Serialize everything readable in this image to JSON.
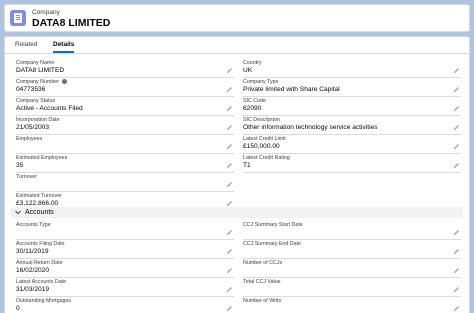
{
  "header": {
    "label": "Company",
    "title": "DATA8 LIMITED"
  },
  "tabs": [
    {
      "label": "Related",
      "active": false
    },
    {
      "label": "Details",
      "active": true
    }
  ],
  "fields": {
    "company_name": {
      "label": "Company Name",
      "value": "DATA8 LIMITED"
    },
    "company_number": {
      "label": "Company Number",
      "value": "04773536"
    },
    "company_status": {
      "label": "Company Status",
      "value": "Active - Accounts Filed"
    },
    "incorporation_date": {
      "label": "Incorporation Date",
      "value": "21/05/2003"
    },
    "employees": {
      "label": "Employees",
      "value": ""
    },
    "estimated_employees": {
      "label": "Estimated Employees",
      "value": "35"
    },
    "turnover": {
      "label": "Turnover",
      "value": ""
    },
    "estimated_turnover": {
      "label": "Estimated Turnover",
      "value": "£3,122,866.00"
    },
    "country": {
      "label": "Country",
      "value": "UK"
    },
    "company_type": {
      "label": "Company Type",
      "value": "Private limited with Share Capital"
    },
    "sic_code": {
      "label": "SIC Code",
      "value": "62090"
    },
    "sic_description": {
      "label": "SIC Description",
      "value": "Other information technology service activities"
    },
    "latest_credit_limit": {
      "label": "Latest Credit Limit",
      "value": "£150,000.00"
    },
    "latest_credit_rating": {
      "label": "Latest Credit Rating",
      "value": "T1"
    }
  },
  "accounts_section": {
    "title": "Accounts",
    "fields": {
      "accounts_type": {
        "label": "Accounts Type",
        "value": ""
      },
      "accounts_filing_date": {
        "label": "Accounts Filing Date",
        "value": "30/11/2019"
      },
      "annual_return_date": {
        "label": "Annual Return Date",
        "value": "16/02/2020"
      },
      "latest_accounts_date": {
        "label": "Latest Accounts Date",
        "value": "31/03/2019"
      },
      "outstanding_mortgages": {
        "label": "Outstanding Mortgages",
        "value": "0"
      },
      "ccj_start_date": {
        "label": "CCJ Summary Start Date",
        "value": ""
      },
      "ccj_end_date": {
        "label": "CCJ Summary End Date",
        "value": ""
      },
      "number_of_ccjs": {
        "label": "Number of CCJs",
        "value": ""
      },
      "total_ccj_value": {
        "label": "Total CCJ Value",
        "value": ""
      },
      "number_of_writs": {
        "label": "Number of Writs",
        "value": ""
      }
    }
  },
  "icons": {
    "header": "company-icon",
    "edit": "pencil-icon",
    "help": "info-icon",
    "collapse": "chevron-down-icon"
  },
  "colors": {
    "background": "#b0c4df",
    "active_tab": "#0070d2",
    "company_icon": "#7f8de1"
  }
}
